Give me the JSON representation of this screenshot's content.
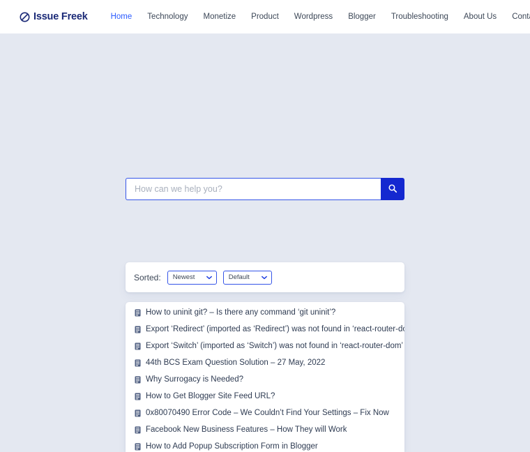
{
  "theme": {
    "page_bg": "#e4e8f1",
    "header_bg": "#ffffff",
    "accent_blue": "#1428d0",
    "link_blue": "#2b5bff",
    "brand_navy": "#1b2a77",
    "text_dark": "#2e3b52",
    "card_bg": "#ffffff"
  },
  "header": {
    "brand": {
      "name": "Issue Freek",
      "icon": "no-entry-circle-slash-icon"
    },
    "nav": [
      {
        "label": "Home",
        "active": true
      },
      {
        "label": "Technology",
        "active": false
      },
      {
        "label": "Monetize",
        "active": false
      },
      {
        "label": "Product",
        "active": false
      },
      {
        "label": "Wordpress",
        "active": false
      },
      {
        "label": "Blogger",
        "active": false
      },
      {
        "label": "Troubleshooting",
        "active": false
      },
      {
        "label": "About Us",
        "active": false
      },
      {
        "label": "Contact Us",
        "active": false
      }
    ]
  },
  "search": {
    "placeholder": "How can we help you?",
    "value": "",
    "button_icon": "search-icon"
  },
  "sort": {
    "label": "Sorted:",
    "order_select": {
      "value": "Newest",
      "options": [
        "Newest"
      ]
    },
    "type_select": {
      "value": "Default",
      "options": [
        "Default"
      ]
    }
  },
  "results": {
    "item_icon": "article-document-icon",
    "items": [
      {
        "title": "How to uninit git? – Is there any command ‘git uninit’?"
      },
      {
        "title": "Export ‘Redirect’ (imported as ‘Redirect’) was not found in ‘react-router-dom’"
      },
      {
        "title": "Export ‘Switch’ (imported as ‘Switch’) was not found in ‘react-router-dom’"
      },
      {
        "title": "44th BCS Exam Question Solution – 27 May, 2022"
      },
      {
        "title": "Why Surrogacy is Needed?"
      },
      {
        "title": "How to Get Blogger Site Feed URL?"
      },
      {
        "title": "0x80070490 Error Code – We Couldn’t Find Your Settings – Fix Now"
      },
      {
        "title": "Facebook New Business Features – How They will Work"
      },
      {
        "title": "How to Add Popup Subscription Form in Blogger"
      }
    ]
  }
}
